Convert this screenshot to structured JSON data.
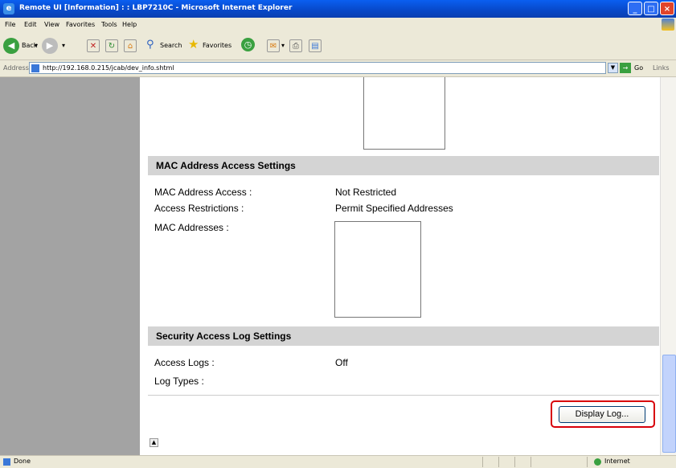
{
  "window": {
    "title": "Remote UI [Information] : : LBP7210C - Microsoft Internet Explorer",
    "controls": [
      "_",
      "□",
      "×"
    ]
  },
  "menu": [
    "File",
    "Edit",
    "View",
    "Favorites",
    "Tools",
    "Help"
  ],
  "toolbar": {
    "back_label": "Back",
    "search_label": "Search",
    "favorites_label": "Favorites"
  },
  "address": {
    "label": "Address",
    "url": "http://192.168.0.215/jcab/dev_info.shtml",
    "go_label": "Go",
    "links_label": "Links"
  },
  "mac_section": {
    "heading": "MAC Address Access Settings",
    "rows": [
      {
        "label": "MAC Address Access :",
        "value": "Not Restricted"
      },
      {
        "label": "Access Restrictions :",
        "value": "Permit Specified Addresses"
      }
    ],
    "addresses_label": "MAC Addresses :"
  },
  "log_section": {
    "heading": "Security Access Log Settings",
    "access_logs_label": "Access Logs :",
    "access_logs_value": "Off",
    "log_types_label": "Log Types :"
  },
  "display_log_button": "Display Log...",
  "status": {
    "text": "Done",
    "zone": "Internet"
  },
  "colors": {
    "title_bar": "#0848c8",
    "section_header": "#d4d4d4",
    "left_nav": "#a3a3a3",
    "highlight": "#d8000a"
  }
}
